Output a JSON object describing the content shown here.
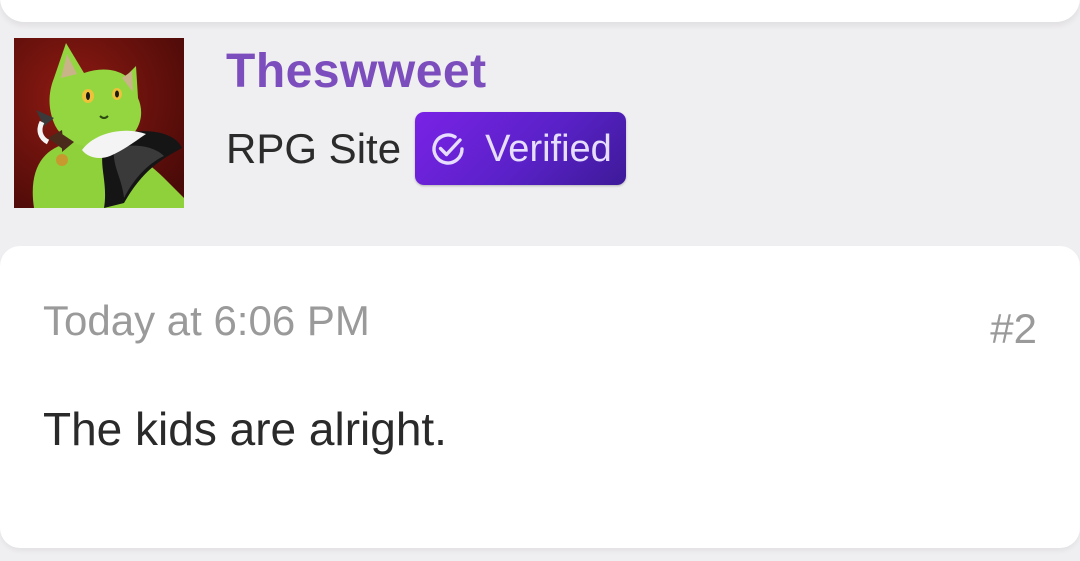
{
  "author": {
    "username": "Theswweet",
    "title": "RPG Site",
    "badge": {
      "icon": "check-circle-icon",
      "label": "Verified"
    },
    "avatar_icon": "green-cat-avatar"
  },
  "post": {
    "timestamp": "Today at 6:06 PM",
    "number": "#2",
    "body": "The kids are alright."
  },
  "colors": {
    "username": "#7c4dbd",
    "badge_bg": "#6a24d8",
    "badge_text": "#e6ddff",
    "page_bg": "#efeef0",
    "muted_text": "#9a9a9a"
  }
}
